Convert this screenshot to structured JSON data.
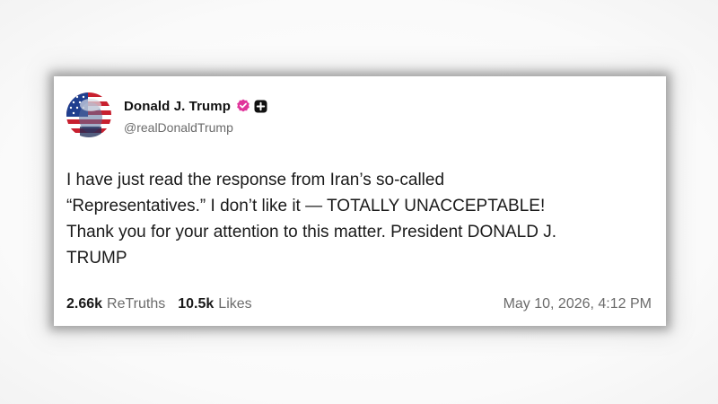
{
  "post": {
    "author": {
      "display_name": "Donald J. Trump",
      "handle": "@realDonaldTrump",
      "verified_badge_color": "#e0359b",
      "avatar": "avatar-flag-portrait"
    },
    "icons": {
      "verified": "verified-check-icon",
      "plus": "plus-badge-icon"
    },
    "body_lines": [
      "I have just read the response from Iran’s so-called",
      "“Representatives.” I don’t like it — TOTALLY UNACCEPTABLE!",
      "Thank you for your attention to this matter. President DONALD J.",
      "TRUMP"
    ],
    "stats": {
      "retruths_count": "2.66k",
      "retruths_label": "ReTruths",
      "likes_count": "10.5k",
      "likes_label": "Likes"
    },
    "timestamp": "May 10, 2026, 4:12 PM"
  },
  "colors": {
    "text_primary": "#111111",
    "text_secondary": "#6b6b6b",
    "flag_red": "#c8202f",
    "flag_blue": "#1f3f8f"
  }
}
